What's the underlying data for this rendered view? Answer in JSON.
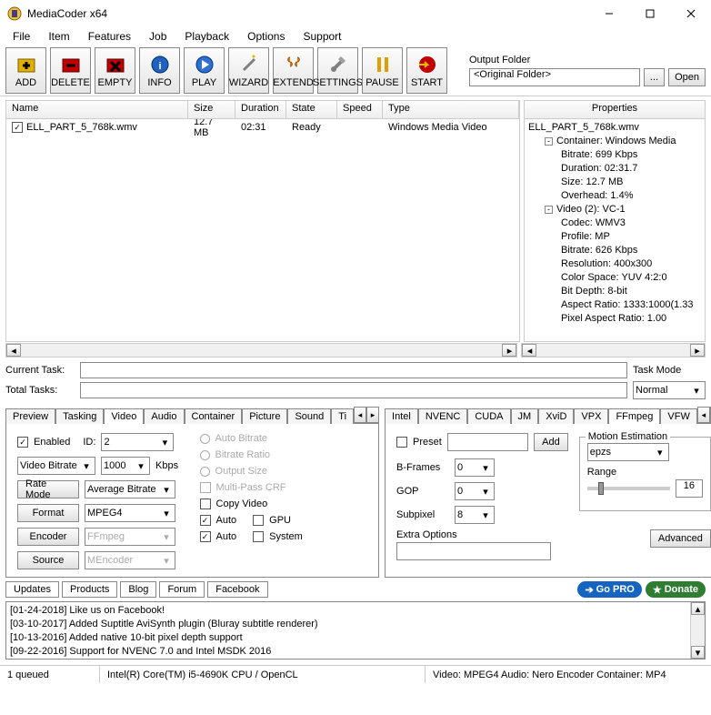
{
  "window": {
    "title": "MediaCoder x64"
  },
  "menu": [
    "File",
    "Item",
    "Features",
    "Job",
    "Playback",
    "Options",
    "Support"
  ],
  "toolbar": [
    {
      "label": "ADD"
    },
    {
      "label": "DELETE"
    },
    {
      "label": "EMPTY"
    },
    {
      "label": "INFO"
    },
    {
      "label": "PLAY"
    },
    {
      "label": "WIZARD"
    },
    {
      "label": "EXTEND"
    },
    {
      "label": "SETTINGS"
    },
    {
      "label": "PAUSE"
    },
    {
      "label": "START"
    }
  ],
  "output": {
    "label": "Output Folder",
    "value": "<Original Folder>",
    "browse": "...",
    "open": "Open"
  },
  "list": {
    "headers": [
      "Name",
      "Size",
      "Duration",
      "State",
      "Speed",
      "Type"
    ],
    "row": {
      "name": "ELL_PART_5_768k.wmv",
      "size": "12.7 MB",
      "duration": "02:31",
      "state": "Ready",
      "speed": "",
      "type": "Windows Media Video"
    }
  },
  "props": {
    "header": "Properties",
    "file": "ELL_PART_5_768k.wmv",
    "container_label": "Container: Windows Media",
    "container": {
      "bitrate": "Bitrate: 699 Kbps",
      "duration": "Duration: 02:31.7",
      "size": "Size: 12.7 MB",
      "overhead": "Overhead: 1.4%"
    },
    "video_label": "Video (2): VC-1",
    "video": {
      "codec": "Codec: WMV3",
      "profile": "Profile: MP",
      "bitrate": "Bitrate: 626 Kbps",
      "resolution": "Resolution: 400x300",
      "colorspace": "Color Space: YUV 4:2:0",
      "bitdepth": "Bit Depth: 8-bit",
      "aspect": "Aspect Ratio: 1333:1000(1.33",
      "par": "Pixel Aspect Ratio: 1.00"
    }
  },
  "tasks": {
    "current_label": "Current Task:",
    "total_label": "Total Tasks:",
    "mode_label": "Task Mode",
    "mode_value": "Normal"
  },
  "tabs_left": [
    "Preview",
    "Tasking",
    "Video",
    "Audio",
    "Container",
    "Picture",
    "Sound",
    "Ti"
  ],
  "tabs_right": [
    "Intel",
    "NVENC",
    "CUDA",
    "JM",
    "XviD",
    "VPX",
    "FFmpeg",
    "VFW"
  ],
  "video_tab": {
    "enabled": "Enabled",
    "id_label": "ID:",
    "id_value": "2",
    "bitrate_mode": "Video Bitrate",
    "bitrate_value": "1000",
    "bitrate_unit": "Kbps",
    "rate_mode_btn": "Rate Mode",
    "rate_mode_val": "Average Bitrate",
    "format_btn": "Format",
    "format_val": "MPEG4",
    "encoder_btn": "Encoder",
    "encoder_val": "FFmpeg",
    "source_btn": "Source",
    "source_val": "MEncoder",
    "auto_bitrate": "Auto Bitrate",
    "bitrate_ratio": "Bitrate Ratio",
    "output_size": "Output Size",
    "multipass": "Multi-Pass CRF",
    "copy_video": "Copy Video",
    "auto": "Auto",
    "gpu": "GPU",
    "system": "System"
  },
  "ffmpeg_tab": {
    "preset": "Preset",
    "add": "Add",
    "bframes": "B-Frames",
    "bframes_val": "0",
    "gop": "GOP",
    "gop_val": "0",
    "subpixel": "Subpixel",
    "subpixel_val": "8",
    "extra": "Extra Options",
    "advanced": "Advanced",
    "me_label": "Motion Estimation",
    "me_val": "epzs",
    "range_label": "Range",
    "range_val": "16"
  },
  "links": [
    "Updates",
    "Products",
    "Blog",
    "Forum",
    "Facebook"
  ],
  "gopro": "Go PRO",
  "donate": "Donate",
  "log": [
    "[01-24-2018] Like us on Facebook!",
    "[03-10-2017] Added Suptitle AviSynth plugin (Bluray subtitle renderer)",
    "[10-13-2016] Added native 10-bit pixel depth support",
    "[09-22-2016] Support for NVENC 7.0 and Intel MSDK 2016"
  ],
  "status": {
    "queued": "1 queued",
    "cpu": "Intel(R) Core(TM) i5-4690K CPU  / OpenCL",
    "codecs": "Video: MPEG4  Audio: Nero Encoder  Container: MP4"
  }
}
